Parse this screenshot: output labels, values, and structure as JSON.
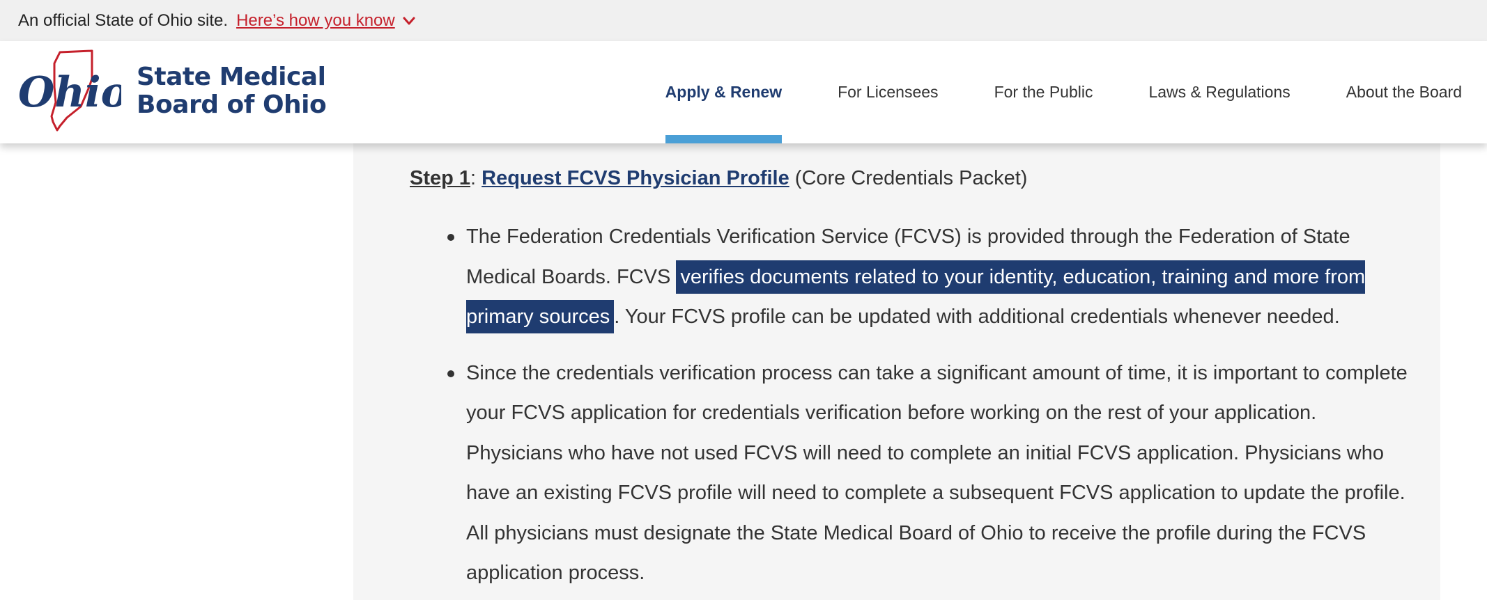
{
  "official_bar": {
    "text": "An official State of Ohio site.",
    "link": "Here’s how you know"
  },
  "header": {
    "logo_text": "Ohio",
    "brand_line1": "State Medical",
    "brand_line2": "Board of Ohio"
  },
  "nav": {
    "items": [
      {
        "label": "Apply & Renew"
      },
      {
        "label": "For Licensees"
      },
      {
        "label": "For the Public"
      },
      {
        "label": "Laws & Regulations"
      },
      {
        "label": "About the Board"
      }
    ]
  },
  "content": {
    "step_number": "Step 1",
    "step_colon": ":",
    "step_link": "Request FCVS Physician Profile",
    "step_suffix": " (Core Credentials Packet)",
    "bullet1_a": "The Federation Credentials Verification Service (FCVS) is provided through the Federation of State Medical Boards. FCVS ",
    "bullet1_highlight": "verifies documents related to your identity, education, training and more from primary sources",
    "bullet1_b": ". Your FCVS profile can be updated with additional credentials whenever needed.",
    "bullet2": "Since the credentials verification process can take a significant amount of time, it is important to complete your FCVS application for credentials verification before working on the rest of your application. Physicians who have not used FCVS will need to complete an initial FCVS application. Physicians who have an existing FCVS profile will need to complete a subsequent FCVS application to update the profile. All physicians must designate the State Medical Board of Ohio to receive the profile during the FCVS application process."
  },
  "colors": {
    "brand_navy": "#1f3c70",
    "official_link_red": "#c5202b",
    "nav_active_underline": "#4a9fd6",
    "panel_bg": "#f5f5f5"
  }
}
